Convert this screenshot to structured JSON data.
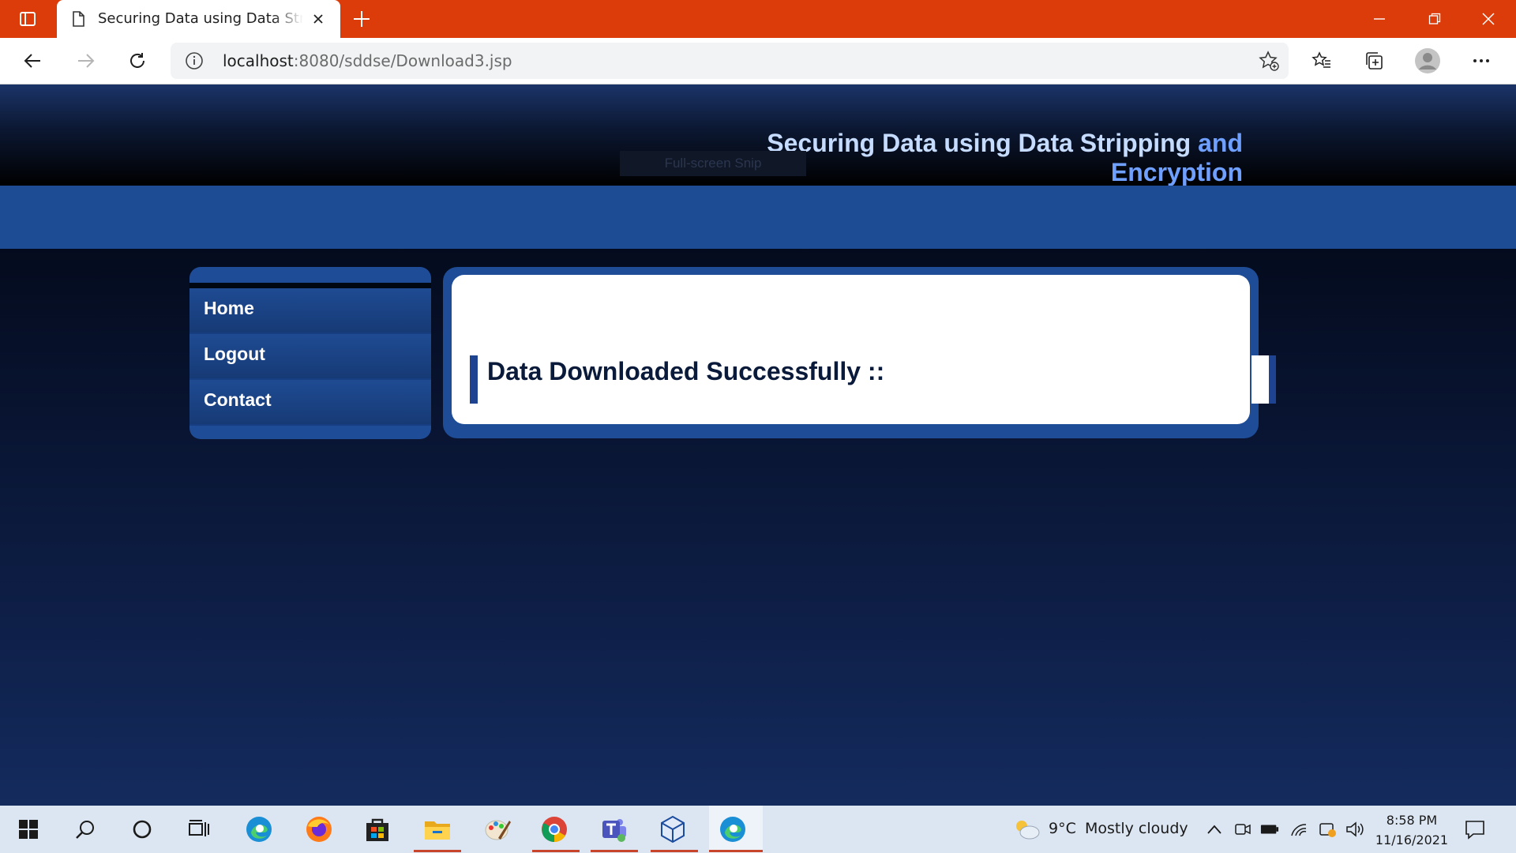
{
  "browser": {
    "tab_title": "Securing Data using Data Stripping and Encryption",
    "address_host": "localhost",
    "address_path": ":8080/sddse/Download3.jsp",
    "accent_color": "#dc3c0a"
  },
  "site": {
    "title_main": "Securing Data using Data Stripping",
    "title_accent_1": "and",
    "title_accent_2": "Encryption",
    "snip_overlay": "Full-screen Snip"
  },
  "nav": {
    "items": [
      {
        "label": "Home"
      },
      {
        "label": "Logout"
      },
      {
        "label": "Contact"
      }
    ]
  },
  "content": {
    "heading": "Data Downloaded Successfully ::"
  },
  "taskbar": {
    "weather_temp": "9°C",
    "weather_condition": "Mostly cloudy",
    "time": "8:58 PM",
    "date": "11/16/2021",
    "apps": [
      "start-icon",
      "search-icon",
      "cortana-icon",
      "task-view-icon",
      "edge-icon",
      "firefox-icon",
      "store-icon",
      "file-explorer-icon",
      "paint-icon",
      "chrome-icon",
      "teams-icon",
      "virtualbox-icon",
      "edge-active-icon"
    ]
  }
}
